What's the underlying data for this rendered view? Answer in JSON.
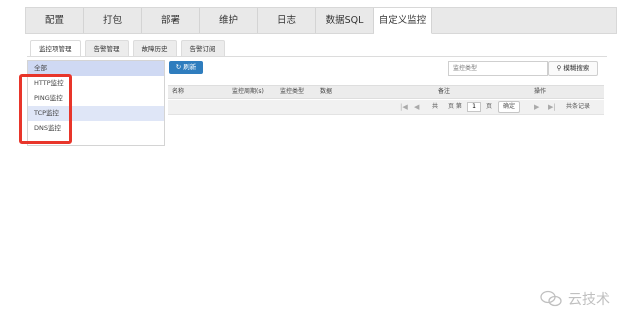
{
  "top_tabs": [
    {
      "label": "配置"
    },
    {
      "label": "打包"
    },
    {
      "label": "部署"
    },
    {
      "label": "维护"
    },
    {
      "label": "日志"
    },
    {
      "label": "数据SQL"
    },
    {
      "label": "自定义监控"
    }
  ],
  "active_top_tab": "自定义监控",
  "sub_tabs": [
    {
      "label": "监控项管理"
    },
    {
      "label": "告警管理"
    },
    {
      "label": "故障历史"
    },
    {
      "label": "告警订阅"
    }
  ],
  "left_list": [
    {
      "label": "全部"
    },
    {
      "label": "HTTP监控"
    },
    {
      "label": "PING监控"
    },
    {
      "label": "TCP监控"
    },
    {
      "label": "DNS监控"
    }
  ],
  "toolbar": {
    "refresh_label": "刷新",
    "search_placeholder": "监控类型",
    "search_button": "模糊搜索"
  },
  "table": {
    "headers": [
      "名称",
      "监控周期(s)",
      "监控类型",
      "数据",
      "备注",
      "操作"
    ]
  },
  "pager": {
    "page_prefix": "共",
    "page_mid": "页 第",
    "page_value": "1",
    "page_suffix": "页",
    "ok_label": "确定",
    "records": "共条记录"
  },
  "watermark": "云技术",
  "colors": {
    "accent": "#2f7dbe",
    "highlight_box": "#e8352a",
    "selected_row": "#cfd9f3"
  }
}
